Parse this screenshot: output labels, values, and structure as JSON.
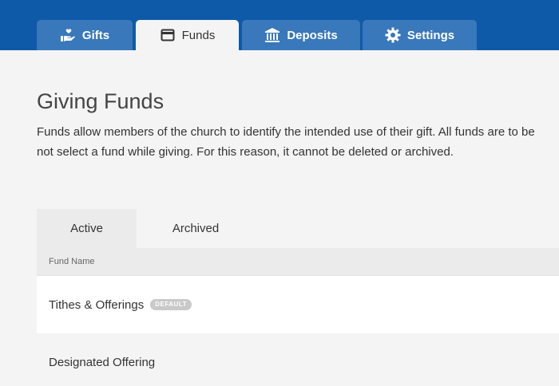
{
  "nav": {
    "tabs": [
      {
        "label": "Gifts",
        "icon": "hand-heart-icon",
        "active": false
      },
      {
        "label": "Funds",
        "icon": "wallet-icon",
        "active": true
      },
      {
        "label": "Deposits",
        "icon": "bank-icon",
        "active": false
      },
      {
        "label": "Settings",
        "icon": "gear-icon",
        "active": false
      }
    ]
  },
  "main": {
    "title": "Giving Funds",
    "description_line1": "Funds allow members of the church to identify the intended use of their gift. All funds are to be",
    "description_line2": "not select a fund while giving. For this reason, it cannot be deleted or archived.",
    "subtabs": [
      {
        "label": "Active",
        "active": true
      },
      {
        "label": "Archived",
        "active": false
      }
    ],
    "table": {
      "column_header": "Fund Name",
      "rows": [
        {
          "name": "Tithes & Offerings",
          "badge": "DEFAULT"
        },
        {
          "name": "Designated Offering",
          "badge": ""
        }
      ]
    }
  },
  "colors": {
    "header_blue": "#0f5aa8",
    "tab_blue": "#3978ba",
    "page_bg": "#f4f4f4"
  }
}
